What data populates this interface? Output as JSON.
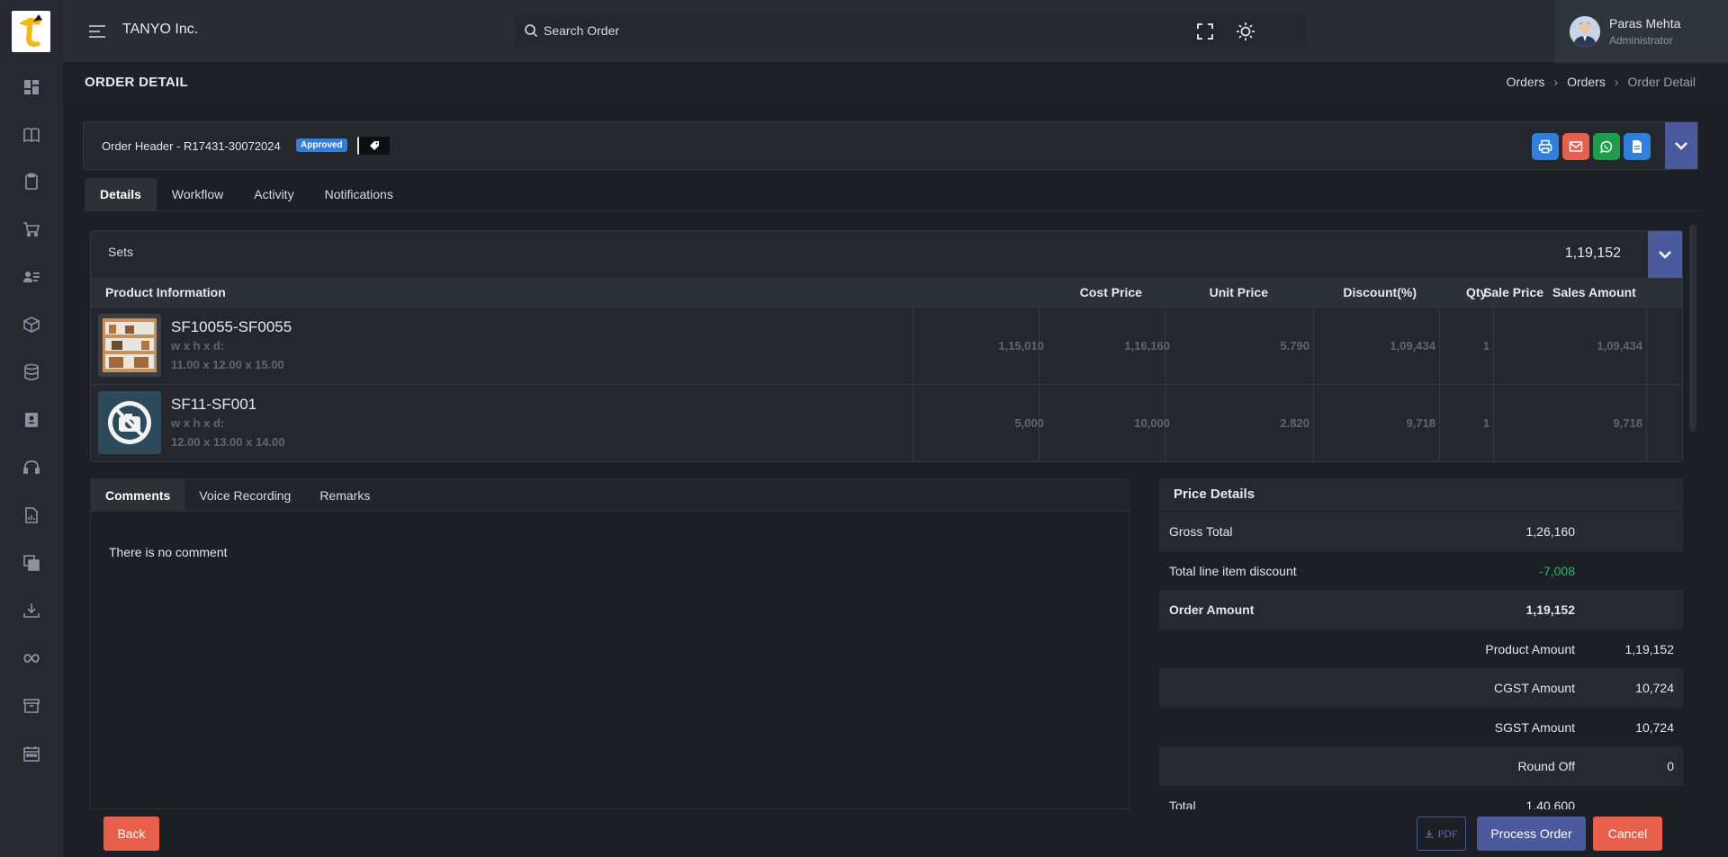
{
  "topbar": {
    "company": "TANYO Inc.",
    "search_placeholder": "Search Order",
    "user_name": "Paras Mehta",
    "user_role": "Administrator"
  },
  "page": {
    "title": "ORDER DETAIL",
    "breadcrumb": [
      "Orders",
      "Orders",
      "Order Detail"
    ]
  },
  "order_header": {
    "title": "Order Header - R17431-30072024",
    "status": "Approved"
  },
  "tabs": [
    "Details",
    "Workflow",
    "Activity",
    "Notifications"
  ],
  "sets": {
    "label": "Sets",
    "total": "1,19,152",
    "columns": [
      "Product Information",
      "Cost Price",
      "Unit Price",
      "Discount(%)",
      "Sale Price",
      "Qty",
      "Sales Amount"
    ],
    "rows": [
      {
        "code": "SF10055-SF0055",
        "dim_label": "w x h x d:",
        "dims": "11.00 x 12.00 x 15.00",
        "cost_price": "1,15,010",
        "unit_price": "1,16,160",
        "discount": "5.790",
        "sale_price": "1,09,434",
        "qty": "1",
        "sales_amount": "1,09,434"
      },
      {
        "code": "SF11-SF001",
        "dim_label": "w x h x d:",
        "dims": "12.00 x 13.00 x 14.00",
        "cost_price": "5,000",
        "unit_price": "10,000",
        "discount": "2.820",
        "sale_price": "9,718",
        "qty": "1",
        "sales_amount": "9,718"
      }
    ]
  },
  "comments": {
    "tabs": [
      "Comments",
      "Voice Recording",
      "Remarks"
    ],
    "empty_text": "There is no comment"
  },
  "price_details": {
    "title": "Price Details",
    "gross_total_label": "Gross Total",
    "gross_total": "1,26,160",
    "discount_label": "Total line item discount",
    "discount": "-7,008",
    "order_amount_label": "Order Amount",
    "order_amount": "1,19,152",
    "product_amount_label": "Product Amount",
    "product_amount": "1,19,152",
    "cgst_label": "CGST Amount",
    "cgst": "10,724",
    "sgst_label": "SGST Amount",
    "sgst": "10,724",
    "round_off_label": "Round Off",
    "round_off": "0",
    "total_label": "Total",
    "total": "1,40,600",
    "discount_color": "#2bb673"
  },
  "footer": {
    "back": "Back",
    "pdf": "PDF",
    "process": "Process Order",
    "cancel": "Cancel"
  },
  "colors": {
    "accent": "#4a5a9c",
    "danger": "#e8604c",
    "approved": "#2f7fdb",
    "print_btn": "#2f7fdb",
    "email_btn": "#e8604c",
    "whatsapp_btn": "#1e9e4a",
    "doc_btn": "#2f7fdb"
  },
  "icons": [
    "dashboard-icon",
    "book-icon",
    "clipboard-icon",
    "cart-icon",
    "users-icon",
    "box-icon",
    "database-icon",
    "contacts-icon",
    "headset-icon",
    "report-icon",
    "copy-icon",
    "download-icon",
    "infinity-icon",
    "archive-icon",
    "calendar-icon"
  ]
}
